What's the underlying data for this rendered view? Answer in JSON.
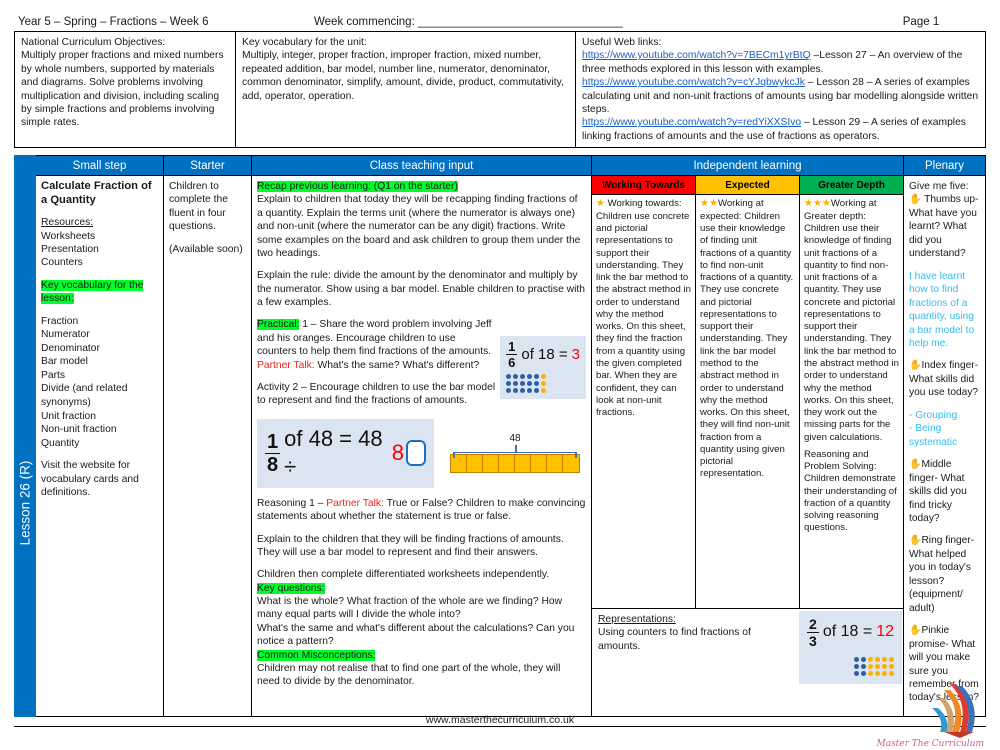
{
  "header": {
    "left": "Year 5 – Spring – Fractions – Week 6",
    "middle": "Week commencing: ________________________________",
    "right": "Page 1"
  },
  "info": {
    "objectives_title": "National Curriculum Objectives:",
    "objectives_body": "Multiply proper fractions and mixed numbers by whole numbers, supported by materials and diagrams. Solve problems involving multiplication and division, including scaling by simple fractions and problems involving simple rates.",
    "vocab_title": "Key vocabulary for the unit:",
    "vocab_body": "Multiply, integer, proper fraction, improper fraction, mixed number, repeated addition, bar model, number line,  numerator, denominator, common denominator, simplify, amount, divide, product, commutativity, add, operator, operation.",
    "links_title": "Useful Web links:",
    "links": [
      {
        "url": "https://www.youtube.com/watch?v=7BECm1yrBtQ",
        "desc": " –Lesson 27 – An overview of the three methods explored in this lesson with examples."
      },
      {
        "url": "https://www.youtube.com/watch?v=cYJqbwykcJk",
        "desc": " – Lesson 28 – A series of examples calculating unit and non-unit fractions of amounts using bar modelling alongside written steps."
      },
      {
        "url": "https://www.youtube.com/watch?v=redYiXXSIvo",
        "desc": " – Lesson 29 – A series of examples linking fractions of amounts and the use of fractions as operators."
      }
    ]
  },
  "lesson_tab": "Lesson 26 (R)",
  "columns": {
    "small_step": "Small step",
    "starter": "Starter",
    "class_input": "Class teaching input",
    "independent": "Independent learning",
    "plenary": "Plenary"
  },
  "small_step": {
    "title": "Calculate Fraction of a Quantity",
    "resources_label": "Resources:",
    "resources": [
      "Worksheets",
      "Presentation",
      "Counters"
    ],
    "vocab_heading": "Key vocabulary for the lesson:",
    "vocab_items": [
      "Fraction",
      "Numerator",
      "Denominator",
      "Bar model",
      "Parts",
      "Divide (and  related synonyms)",
      "Unit fraction",
      "Non-unit fraction",
      "Quantity"
    ],
    "website_note": "Visit the website for vocabulary cards and definitions."
  },
  "starter": {
    "line1": "Children to complete the fluent in four questions.",
    "line2": "(Available soon)"
  },
  "class_input": {
    "recap_heading": "Recap previous learning: (Q1 on the starter)",
    "recap_body": "Explain to children that today they will be recapping finding fractions of a quantity. Explain the terms unit (where the numerator is always one) and non-unit (where the numerator can be any digit) fractions. Write some examples on the board and ask children to group them under the two headings.",
    "rule_body": "Explain the rule: divide the amount by the denominator and multiply by the numerator. Show using a bar model.  Enable children to practise with a few examples.",
    "practical_label": "Practical:",
    "practical_body": " 1 – Share the word problem involving Jeff and his oranges. Encourage children to use counters  to help them find fractions of the amounts.",
    "partner_talk_label": "Partner Talk:",
    "partner_talk_body": " What's the same? What's different?",
    "activity2": "Activity 2 – Encourage children to use the bar model to represent and find the fractions of amounts.",
    "reasoning_pre": "Reasoning 1 – ",
    "reasoning_label": "Partner Talk:",
    "reasoning_body": " True or False? Children to make convincing statements about whether the statement is true or false.",
    "explain_body": "Explain to the children that they will be finding fractions of amounts. They will use a bar model to represent and find their answers.",
    "worksheets_body": "Children then complete differentiated worksheets independently.",
    "key_questions_heading": "Key questions:",
    "key_questions_body": "What is the whole? What fraction of the whole are we finding? How many equal parts will I divide the whole into?\nWhat's the same and what's different about the calculations? Can you notice a pattern?",
    "misconceptions_heading": "Common Misconceptions:",
    "misconceptions_body": "Children may not realise that to find one part of the whole, they will need to divide by the denominator.",
    "example1": {
      "numerator": "1",
      "denominator": "6",
      "text": "of 18 =",
      "answer": "3"
    },
    "example2": {
      "numerator": "1",
      "denominator": "8",
      "text": "of 48 = 48 ÷",
      "divisor": "8"
    },
    "barmodel": {
      "label": "48",
      "segments": 8
    }
  },
  "independent": {
    "sub_headers": [
      {
        "label": "Working Towards",
        "color": "#FF0000"
      },
      {
        "label": "Expected",
        "color": "#FFC000"
      },
      {
        "label": "Greater Depth",
        "color": "#00B050"
      }
    ],
    "working_towards": {
      "stars": "★",
      "heading": " Working towards:",
      "body": "Children use concrete and pictorial representations to support their understanding. They link the bar method to the abstract method in order to understand why the method works. On this sheet, they find the fraction from a quantity using the given completed bar. When they are confident, they can look at non-unit fractions."
    },
    "expected": {
      "stars": "★★",
      "heading": "Working at expected:",
      "body": "Children use their knowledge of finding unit fractions of a quantity to find non-unit fractions of a quantity. They use concrete and pictorial representations to support their understanding. They link the bar model method to the abstract method in order to understand why the method works. On this sheet, they will find non-unit fraction from a quantity using given pictorial representation."
    },
    "greater_depth": {
      "stars": "★★★",
      "heading": "Working at Greater depth:",
      "body": "Children use their knowledge of finding unit fractions of a quantity to find non-unit fractions of a quantity. They use concrete and pictorial representations to support their understanding. They link the bar method to the abstract method in order to understand why the method works. On this sheet, they work out the missing parts for the given calculations.",
      "body2": "Reasoning and Problem Solving: Children demonstrate their understanding of fraction of a quantity solving reasoning questions."
    },
    "representations": {
      "heading": "Representations:",
      "body": "Using counters to find fractions of amounts.",
      "example": {
        "numerator": "2",
        "denominator": "3",
        "text": "of 18 =",
        "answer": "12"
      }
    }
  },
  "plenary": {
    "intro": "Give me five:",
    "items": [
      {
        "hand": "✋",
        "text": " Thumbs up- What have you learnt? What did you understand?"
      },
      {
        "hand": "✋",
        "text": "Index finger- What skills did you use today?"
      },
      {
        "hand": "✋",
        "text": "Middle finger- What skills did you find tricky today?"
      },
      {
        "hand": "✋",
        "text": "Ring finger- What helped you in today's lesson? (equipment/ adult)"
      },
      {
        "hand": "✋",
        "text": "Pinkie promise- What will you make sure you remember from today's lesson?"
      }
    ],
    "answer1": "I have learnt how to find fractions of a quantity, using a bar model to help me.",
    "answer2": "- Grouping\n- Being systematic"
  },
  "footer": {
    "url": "www.masterthecurriculum.co.uk",
    "logo_text": "Master The Curriculum"
  },
  "colors": {
    "header_blue": "#0070C0",
    "highlight_green": "#00FF2A",
    "red": "#FF0000",
    "amber": "#FFC000",
    "green": "#00B050",
    "cyan": "#34BDEF"
  }
}
